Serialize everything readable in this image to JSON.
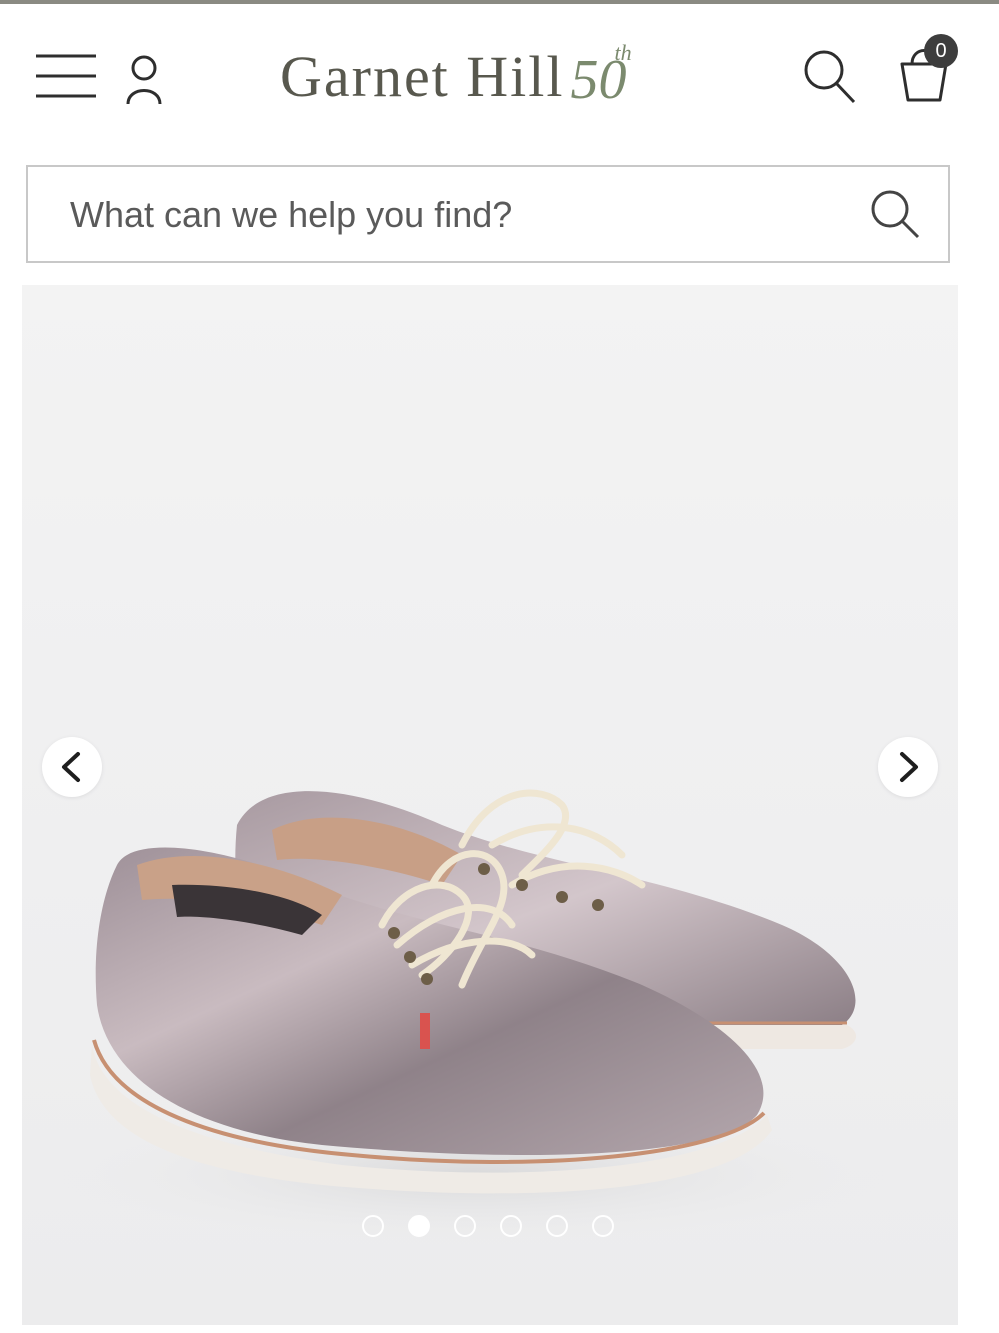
{
  "header": {
    "logo_text": "Garnet Hill",
    "anniversary_number": "50",
    "anniversary_suffix": "th",
    "cart_count": "0",
    "icons": {
      "menu": "hamburger-menu-icon",
      "account": "user-account-icon",
      "search": "search-icon",
      "cart": "shopping-bag-icon"
    }
  },
  "search": {
    "placeholder": "What can we help you find?"
  },
  "carousel": {
    "image_subject": "pair of metallic pewter leather lace-up oxford shoes",
    "slide_count": 6,
    "active_slide": 2,
    "prev_icon": "chevron-left-icon",
    "next_icon": "chevron-right-icon"
  },
  "colors": {
    "logo": "#58584e",
    "logo_accent": "#7b8a6e",
    "badge": "#3d3d3d",
    "border": "#c8c8c8"
  }
}
